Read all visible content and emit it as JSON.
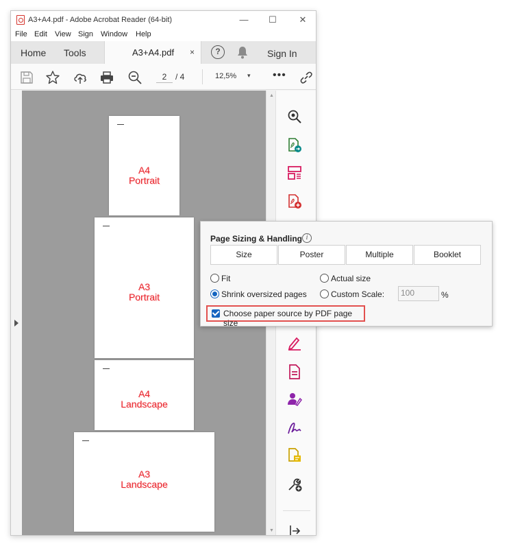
{
  "window": {
    "title": "A3+A4.pdf - Adobe Acrobat Reader (64-bit)",
    "controls": {
      "minimize": "—",
      "maximize": "☐",
      "close": "✕"
    }
  },
  "menu": [
    "File",
    "Edit",
    "View",
    "Sign",
    "Window",
    "Help"
  ],
  "tabs": {
    "home": "Home",
    "tools": "Tools",
    "document": "A3+A4.pdf",
    "close_glyph": "×",
    "help_glyph": "?",
    "sign_in": "Sign In"
  },
  "toolbar": {
    "current_page": "2",
    "total_pages": "/ 4",
    "zoom": "12,5%",
    "zoom_caret": "▾",
    "more": "•••"
  },
  "pages": [
    {
      "line1": "A4",
      "line2": "Portrait"
    },
    {
      "line1": "A3",
      "line2": "Portrait"
    },
    {
      "line1": "A4",
      "line2": "Landscape"
    },
    {
      "line1": "A3",
      "line2": "Landscape"
    }
  ],
  "print_panel": {
    "title": "Page Sizing & Handling",
    "info_glyph": "i",
    "buttons": [
      "Size",
      "Poster",
      "Multiple",
      "Booklet"
    ],
    "options": {
      "fit": "Fit",
      "actual_size": "Actual size",
      "shrink": "Shrink oversized pages",
      "custom_scale": "Custom Scale:",
      "scale_value": "100",
      "percent": "%"
    },
    "paper_source": "Choose paper source by PDF page size"
  },
  "colors": {
    "accent": "#1565c0",
    "highlight_box": "#e2504e",
    "page_label": "#e8222a"
  }
}
